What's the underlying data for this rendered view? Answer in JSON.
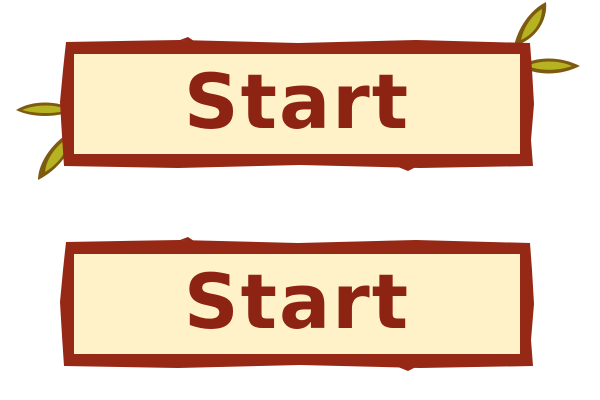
{
  "buttons": [
    {
      "state": "hover",
      "label": "Start",
      "decoration": "leaf-icon"
    },
    {
      "state": "normal",
      "label": "Start"
    }
  ],
  "colors": {
    "frame": "#962816",
    "panel": "#fff2c8",
    "text": "#8c2313",
    "leaf_outer": "#7e5a10",
    "leaf_inner": "#b5b321"
  }
}
